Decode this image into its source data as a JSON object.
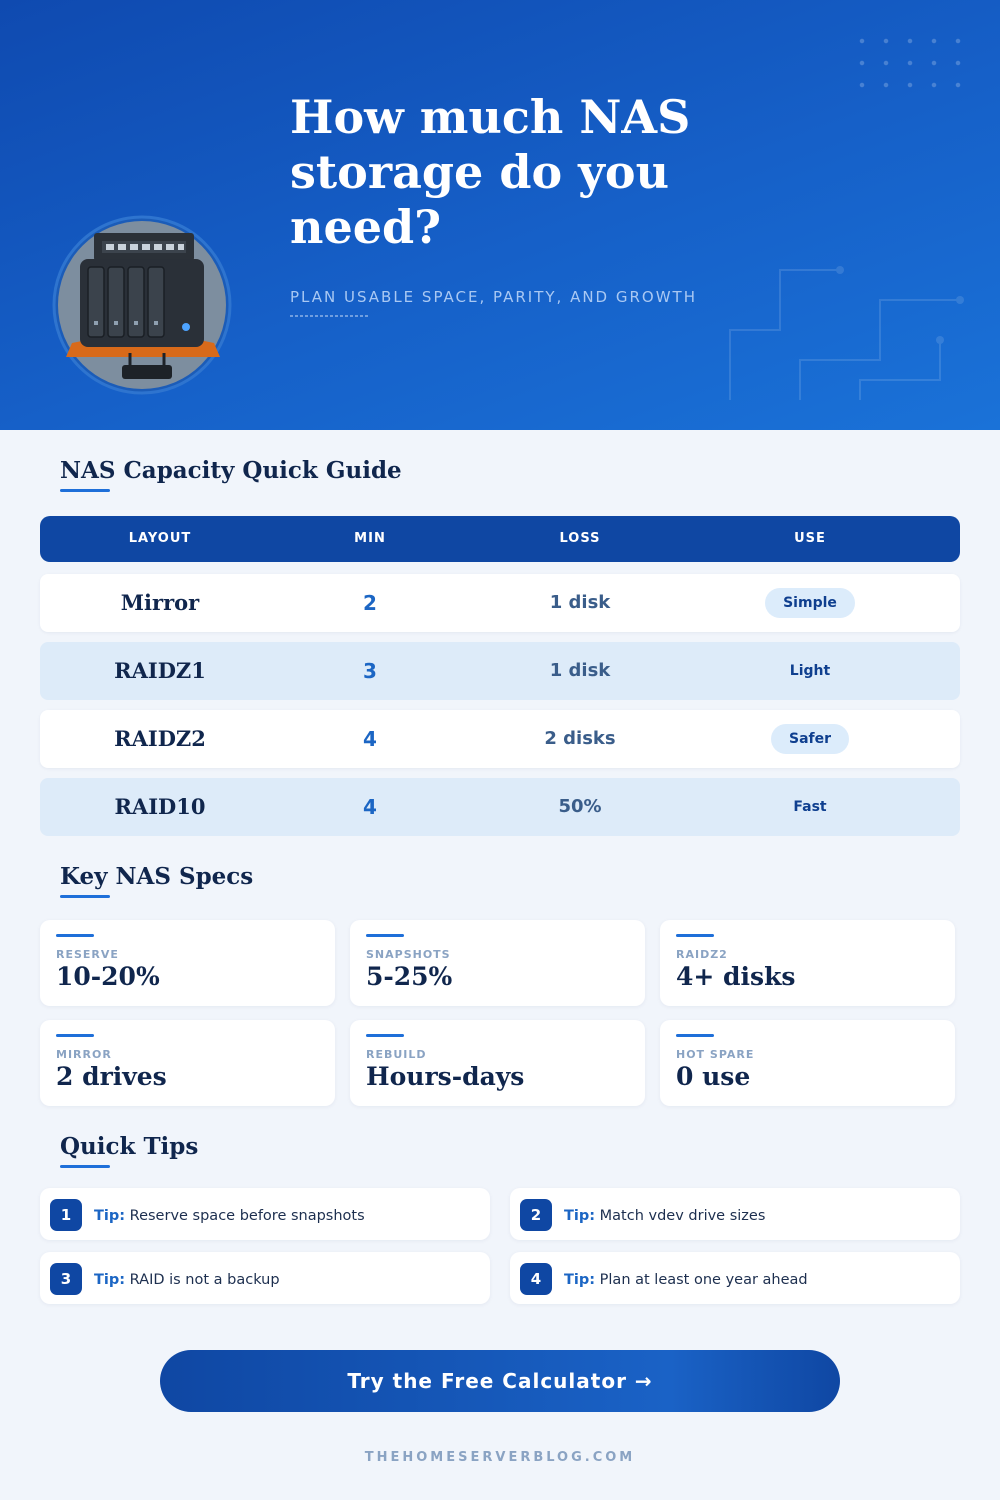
{
  "hero": {
    "title": "How much NAS storage do you need?",
    "subtitle": "PLAN USABLE SPACE, PARITY, AND GROWTH"
  },
  "guide": {
    "title": "NAS Capacity Quick Guide",
    "columns": [
      "LAYOUT",
      "MIN",
      "LOSS",
      "USE"
    ],
    "rows": [
      {
        "layout": "Mirror",
        "min": "2",
        "loss": "1 disk",
        "use": "Simple"
      },
      {
        "layout": "RAIDZ1",
        "min": "3",
        "loss": "1 disk",
        "use": "Light"
      },
      {
        "layout": "RAIDZ2",
        "min": "4",
        "loss": "2 disks",
        "use": "Safer"
      },
      {
        "layout": "RAID10",
        "min": "4",
        "loss": "50%",
        "use": "Fast"
      }
    ]
  },
  "specs": {
    "title": "Key NAS Specs",
    "items": [
      {
        "label": "RESERVE",
        "value": "10-20%"
      },
      {
        "label": "SNAPSHOTS",
        "value": "5-25%"
      },
      {
        "label": "RAIDZ2",
        "value": "4+ disks"
      },
      {
        "label": "MIRROR",
        "value": "2 drives"
      },
      {
        "label": "REBUILD",
        "value": "Hours-days"
      },
      {
        "label": "HOT SPARE",
        "value": "0 use"
      }
    ]
  },
  "tips": {
    "title": "Quick Tips",
    "prefix": "Tip:",
    "items": [
      {
        "num": "1",
        "text": "Reserve space before snapshots"
      },
      {
        "num": "2",
        "text": "Match vdev drive sizes"
      },
      {
        "num": "3",
        "text": "RAID is not a backup"
      },
      {
        "num": "4",
        "text": "Plan at least one year ahead"
      }
    ]
  },
  "cta": {
    "label": "Try the Free Calculator →"
  },
  "footer": {
    "site": "THEHOMESERVERBLOG.COM"
  },
  "colors": {
    "primary": "#0f47a3",
    "accent": "#1e6fd9",
    "hero_bg": "#1660c8",
    "row_alt": "#ddebf9"
  },
  "icons": {
    "hero_illustration": "nas-device-icon"
  }
}
